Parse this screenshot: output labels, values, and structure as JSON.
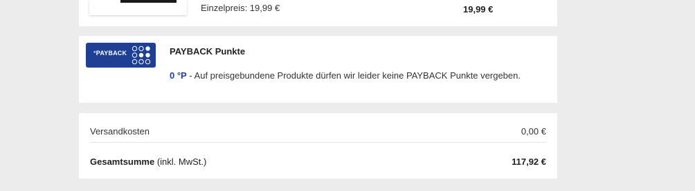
{
  "product": {
    "unit_price_label": "Einzelpreis: 19,99 €",
    "line_total": "19,99 €"
  },
  "payback": {
    "logo_text": "°PAYBACK",
    "title": "PAYBACK Punkte",
    "points": "0 °P",
    "message": " - Auf preisgebundene Produkte dürfen wir leider keine PAYBACK Punkte vergeben.",
    "brand_color": "#1f3f94"
  },
  "summary": {
    "shipping_label": "Versandkosten",
    "shipping_value": "0,00 €",
    "total_label": "Gesamtsumme",
    "total_suffix": " (inkl. MwSt.)",
    "total_value": "117,92 €"
  }
}
